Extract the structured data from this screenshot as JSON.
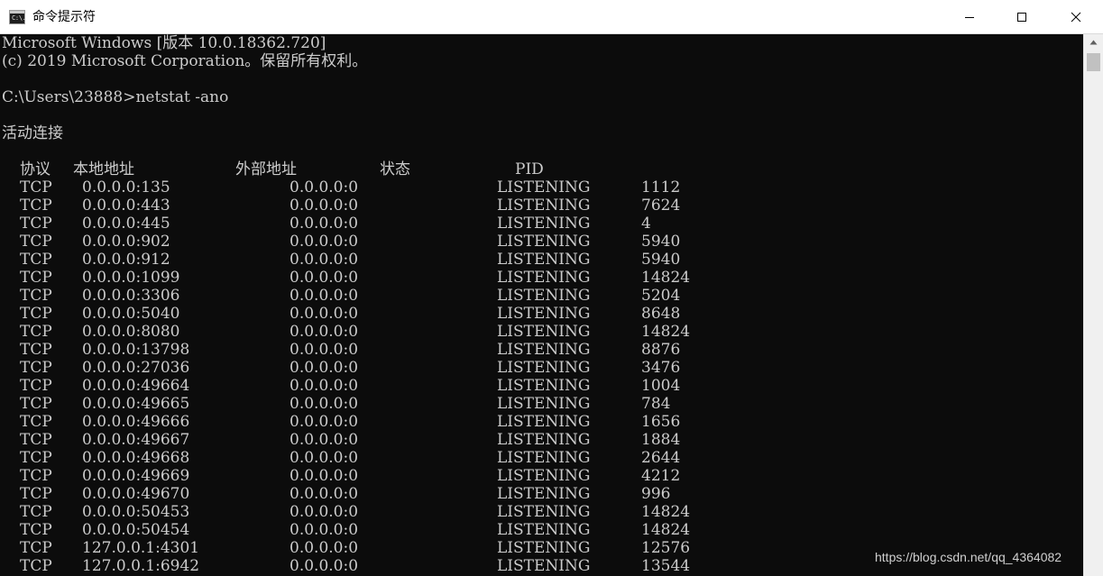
{
  "window": {
    "title": "命令提示符",
    "icon_label": "C:\\.",
    "buttons": [
      "minimize-icon",
      "maximize-icon",
      "close-icon"
    ]
  },
  "console": {
    "banner_line1": "Microsoft Windows [版本 10.0.18362.720]",
    "banner_line2": "(c) 2019 Microsoft Corporation。保留所有权利。",
    "prompt_command": "C:\\Users\\23888>netstat -ano",
    "section_title": "活动连接",
    "headers": {
      "proto": "协议",
      "local": "本地地址",
      "foreign": "外部地址",
      "state": "状态",
      "pid": "PID"
    },
    "rows": [
      {
        "proto": "TCP",
        "local": "0.0.0.0:135",
        "foreign": "0.0.0.0:0",
        "state": "LISTENING",
        "pid": "1112"
      },
      {
        "proto": "TCP",
        "local": "0.0.0.0:443",
        "foreign": "0.0.0.0:0",
        "state": "LISTENING",
        "pid": "7624"
      },
      {
        "proto": "TCP",
        "local": "0.0.0.0:445",
        "foreign": "0.0.0.0:0",
        "state": "LISTENING",
        "pid": "4"
      },
      {
        "proto": "TCP",
        "local": "0.0.0.0:902",
        "foreign": "0.0.0.0:0",
        "state": "LISTENING",
        "pid": "5940"
      },
      {
        "proto": "TCP",
        "local": "0.0.0.0:912",
        "foreign": "0.0.0.0:0",
        "state": "LISTENING",
        "pid": "5940"
      },
      {
        "proto": "TCP",
        "local": "0.0.0.0:1099",
        "foreign": "0.0.0.0:0",
        "state": "LISTENING",
        "pid": "14824"
      },
      {
        "proto": "TCP",
        "local": "0.0.0.0:3306",
        "foreign": "0.0.0.0:0",
        "state": "LISTENING",
        "pid": "5204"
      },
      {
        "proto": "TCP",
        "local": "0.0.0.0:5040",
        "foreign": "0.0.0.0:0",
        "state": "LISTENING",
        "pid": "8648"
      },
      {
        "proto": "TCP",
        "local": "0.0.0.0:8080",
        "foreign": "0.0.0.0:0",
        "state": "LISTENING",
        "pid": "14824"
      },
      {
        "proto": "TCP",
        "local": "0.0.0.0:13798",
        "foreign": "0.0.0.0:0",
        "state": "LISTENING",
        "pid": "8876"
      },
      {
        "proto": "TCP",
        "local": "0.0.0.0:27036",
        "foreign": "0.0.0.0:0",
        "state": "LISTENING",
        "pid": "3476"
      },
      {
        "proto": "TCP",
        "local": "0.0.0.0:49664",
        "foreign": "0.0.0.0:0",
        "state": "LISTENING",
        "pid": "1004"
      },
      {
        "proto": "TCP",
        "local": "0.0.0.0:49665",
        "foreign": "0.0.0.0:0",
        "state": "LISTENING",
        "pid": "784"
      },
      {
        "proto": "TCP",
        "local": "0.0.0.0:49666",
        "foreign": "0.0.0.0:0",
        "state": "LISTENING",
        "pid": "1656"
      },
      {
        "proto": "TCP",
        "local": "0.0.0.0:49667",
        "foreign": "0.0.0.0:0",
        "state": "LISTENING",
        "pid": "1884"
      },
      {
        "proto": "TCP",
        "local": "0.0.0.0:49668",
        "foreign": "0.0.0.0:0",
        "state": "LISTENING",
        "pid": "2644"
      },
      {
        "proto": "TCP",
        "local": "0.0.0.0:49669",
        "foreign": "0.0.0.0:0",
        "state": "LISTENING",
        "pid": "4212"
      },
      {
        "proto": "TCP",
        "local": "0.0.0.0:49670",
        "foreign": "0.0.0.0:0",
        "state": "LISTENING",
        "pid": "996"
      },
      {
        "proto": "TCP",
        "local": "0.0.0.0:50453",
        "foreign": "0.0.0.0:0",
        "state": "LISTENING",
        "pid": "14824"
      },
      {
        "proto": "TCP",
        "local": "0.0.0.0:50454",
        "foreign": "0.0.0.0:0",
        "state": "LISTENING",
        "pid": "14824"
      },
      {
        "proto": "TCP",
        "local": "127.0.0.1:4301",
        "foreign": "0.0.0.0:0",
        "state": "LISTENING",
        "pid": "12576"
      },
      {
        "proto": "TCP",
        "local": "127.0.0.1:6942",
        "foreign": "0.0.0.0:0",
        "state": "LISTENING",
        "pid": "13544"
      }
    ]
  },
  "watermark": "https://blog.csdn.net/qq_4364082",
  "colors": {
    "console_bg": "#0c0c0c",
    "console_fg": "#cccccc",
    "titlebar_bg": "#ffffff",
    "scrollbar_bg": "#f0f0f0",
    "scroll_thumb": "#c1c1c1"
  }
}
